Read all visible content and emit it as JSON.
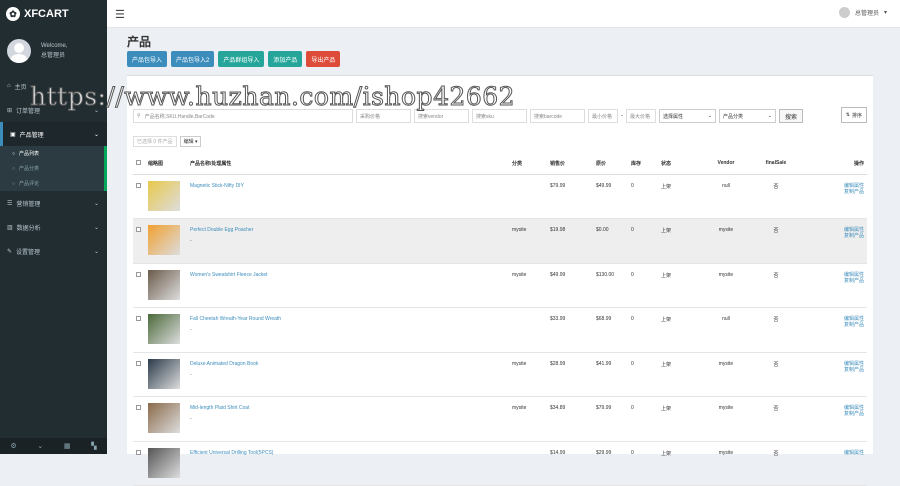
{
  "brand": {
    "name": "XFCART"
  },
  "user": {
    "welcome": "Welcome,",
    "name": "总管理员"
  },
  "nav": {
    "item0": "主页",
    "item1": "订单管理",
    "item2": "产品管理",
    "sub0": "产品列表",
    "sub1": "产品分类",
    "sub2": "产品评论",
    "item3": "营销管理",
    "item4": "数据分析",
    "item5": "设置管理"
  },
  "topbar": {
    "user": "总管理员"
  },
  "page": {
    "title": "产品"
  },
  "actions": {
    "b0": "产品包导入",
    "b1": "产品包导入2",
    "b2": "产品群组导入",
    "b3": "添加产品",
    "b4": "导出产品"
  },
  "filters": {
    "search_placeholder": "产品名称,SKU,Handle,BarCode",
    "f1": "采购价格",
    "f2": "搜索vendor",
    "f3": "搜索sku",
    "f4": "搜索barcode",
    "min_price": "最小价格",
    "max_price": "最大价格",
    "sel1": "选择属性",
    "sel2": "产品分类",
    "search_btn": "搜索",
    "sort_btn": "排序"
  },
  "bulk": {
    "selected": "已选择 0 件产品",
    "edit": "编辑"
  },
  "table": {
    "headers": {
      "thumb": "缩略图",
      "name": "产品名称/处理属性",
      "cat": "分类",
      "price": "销售价",
      "cost": "原价",
      "stock": "库存",
      "status": "状态",
      "vendor": "Vendor",
      "final": "finalSale",
      "ops": "操作"
    },
    "rows": [
      {
        "name": "Magnetic Stick-Nifty DIY",
        "sub": "",
        "cat": "",
        "price": "$79.99",
        "cost": "$49.99",
        "stock": "0",
        "status": "上架",
        "vendor": "null",
        "final": "否",
        "op1": "编辑属性",
        "op2": "复制产品"
      },
      {
        "name": "Perfect Double Egg Poacher",
        "sub": "-",
        "cat": "mysite",
        "price": "$19.98",
        "cost": "$0.00",
        "stock": "0",
        "status": "上架",
        "vendor": "mysite",
        "final": "否",
        "op1": "编辑属性",
        "op2": "复制产品"
      },
      {
        "name": "Women's Sweatshirt Fleece Jacket",
        "sub": "",
        "cat": "mysite",
        "price": "$49.99",
        "cost": "$130.00",
        "stock": "0",
        "status": "上架",
        "vendor": "mysite",
        "final": "否",
        "op1": "编辑属性",
        "op2": "复制产品"
      },
      {
        "name": "Fall Cheetah Wreath-Year Round Wreath",
        "sub": "-",
        "cat": "",
        "price": "$33.99",
        "cost": "$68.99",
        "stock": "0",
        "status": "上架",
        "vendor": "null",
        "final": "否",
        "op1": "编辑属性",
        "op2": "复制产品"
      },
      {
        "name": "Deluxe Animated Dragon Book",
        "sub": "-",
        "cat": "mysite",
        "price": "$28.99",
        "cost": "$41.99",
        "stock": "0",
        "status": "上架",
        "vendor": "mysite",
        "final": "否",
        "op1": "编辑属性",
        "op2": "复制产品"
      },
      {
        "name": "Mid-length Plaid Shirt Coat",
        "sub": "-",
        "cat": "mysite",
        "price": "$34.89",
        "cost": "$79.99",
        "stock": "0",
        "status": "上架",
        "vendor": "mysite",
        "final": "否",
        "op1": "编辑属性",
        "op2": "复制产品"
      },
      {
        "name": "Efficient Universal Drilling Tool(5PCS)",
        "sub": "",
        "cat": "",
        "price": "$14.99",
        "cost": "$29.99",
        "stock": "0",
        "status": "上架",
        "vendor": "mysite",
        "final": "否",
        "op1": "编辑属性",
        "op2": ""
      }
    ]
  },
  "thumb_colors": [
    "#e8c84a",
    "#f0a030",
    "#6b5b4a",
    "#4a6a3a",
    "#2a3a4a",
    "#8a6a4a",
    "#555555"
  ],
  "watermark": "https://www.huzhan.com/ishop42662",
  "colors": {
    "sidebar": "#222d32",
    "accent": "#3c8dbc",
    "teal": "#26a69a",
    "red": "#dd4b39"
  }
}
